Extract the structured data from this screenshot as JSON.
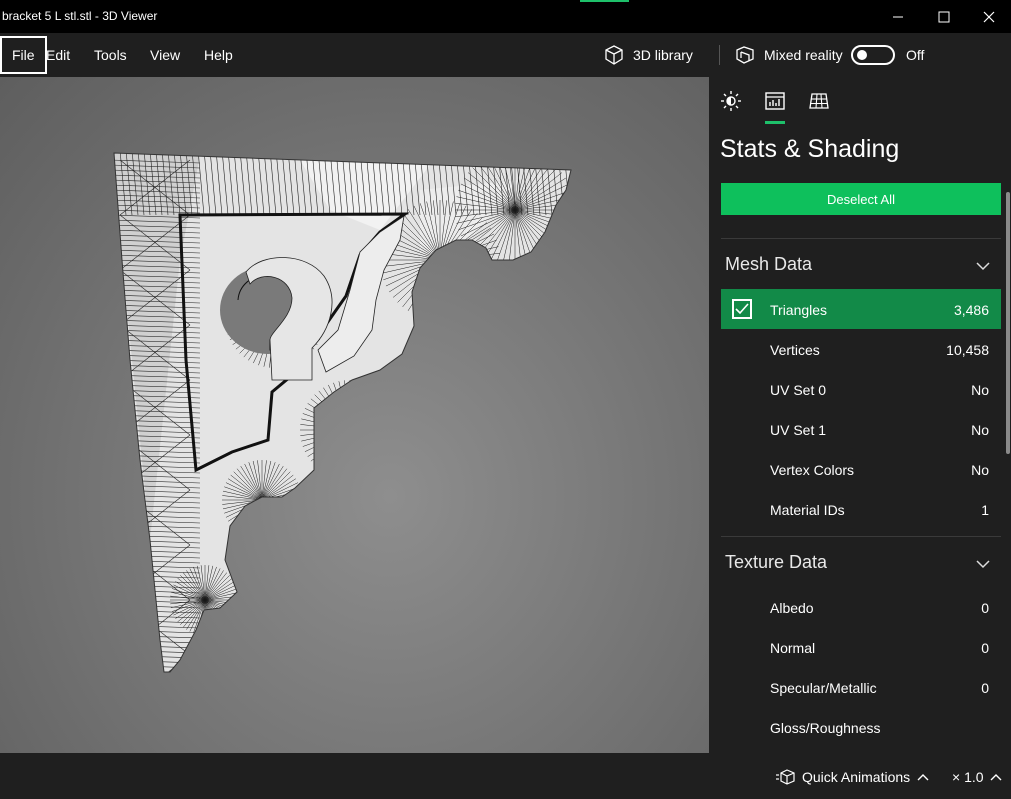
{
  "window": {
    "title": "bracket 5 L stl.stl - 3D Viewer",
    "accent": "#1ec06a"
  },
  "menu": {
    "file": "File",
    "edit": "Edit",
    "tools": "Tools",
    "view": "View",
    "help": "Help",
    "library": "3D library",
    "mixed_reality": "Mixed reality",
    "toggle_state": "Off",
    "toggle_on": false
  },
  "panel": {
    "tabs": [
      "lighting-icon",
      "stats-icon",
      "grid-icon"
    ],
    "active_tab": "stats",
    "title": "Stats & Shading",
    "deselect_label": "Deselect All",
    "mesh_section": "Mesh Data",
    "mesh_rows": [
      {
        "label": "Triangles",
        "value": "3,486",
        "selected": true
      },
      {
        "label": "Vertices",
        "value": "10,458"
      },
      {
        "label": "UV Set 0",
        "value": "No"
      },
      {
        "label": "UV Set 1",
        "value": "No"
      },
      {
        "label": "Vertex Colors",
        "value": "No"
      },
      {
        "label": "Material IDs",
        "value": "1"
      }
    ],
    "texture_section": "Texture Data",
    "texture_rows": [
      {
        "label": "Albedo",
        "value": "0"
      },
      {
        "label": "Normal",
        "value": "0"
      },
      {
        "label": "Specular/Metallic",
        "value": "0"
      },
      {
        "label": "Gloss/Roughness",
        "value": ""
      }
    ]
  },
  "bottom": {
    "animations": "Quick Animations",
    "speed": "× 1.0"
  }
}
